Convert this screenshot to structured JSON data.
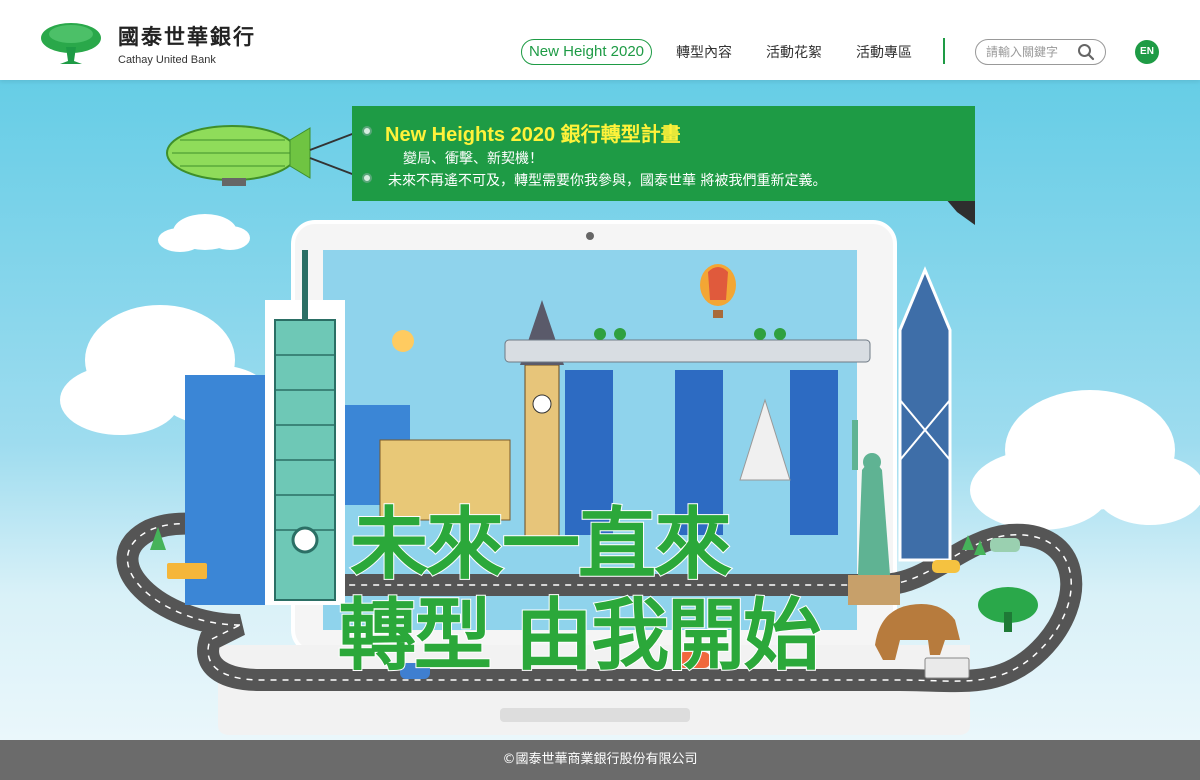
{
  "brand": {
    "name_cn": "國泰世華銀行",
    "name_en": "Cathay United Bank",
    "logo_icon": "tree-logo-icon",
    "accent_color": "#1e9b45"
  },
  "nav": {
    "items": [
      {
        "label": "New Height 2020",
        "active": true
      },
      {
        "label": "轉型內容"
      },
      {
        "label": "活動花絮"
      },
      {
        "label": "活動專區"
      }
    ],
    "search_placeholder": "請輸入關鍵字",
    "search_icon": "search-icon",
    "lang_button": "EN"
  },
  "hero": {
    "banner_title_en": "New Heights 2020",
    "banner_title_cn": "銀行轉型計畫",
    "banner_line1": "變局、衝擊、新契機！",
    "banner_line2": "未來不再遙不可及，轉型需要你我參與，國泰世華 將被我們重新定義。",
    "slogan_line1": "未來一直來",
    "slogan_line2": "轉型 由我開始",
    "slogan_color": "#2ba83a"
  },
  "footer": {
    "copyright": "©國泰世華商業銀行股份有限公司"
  }
}
